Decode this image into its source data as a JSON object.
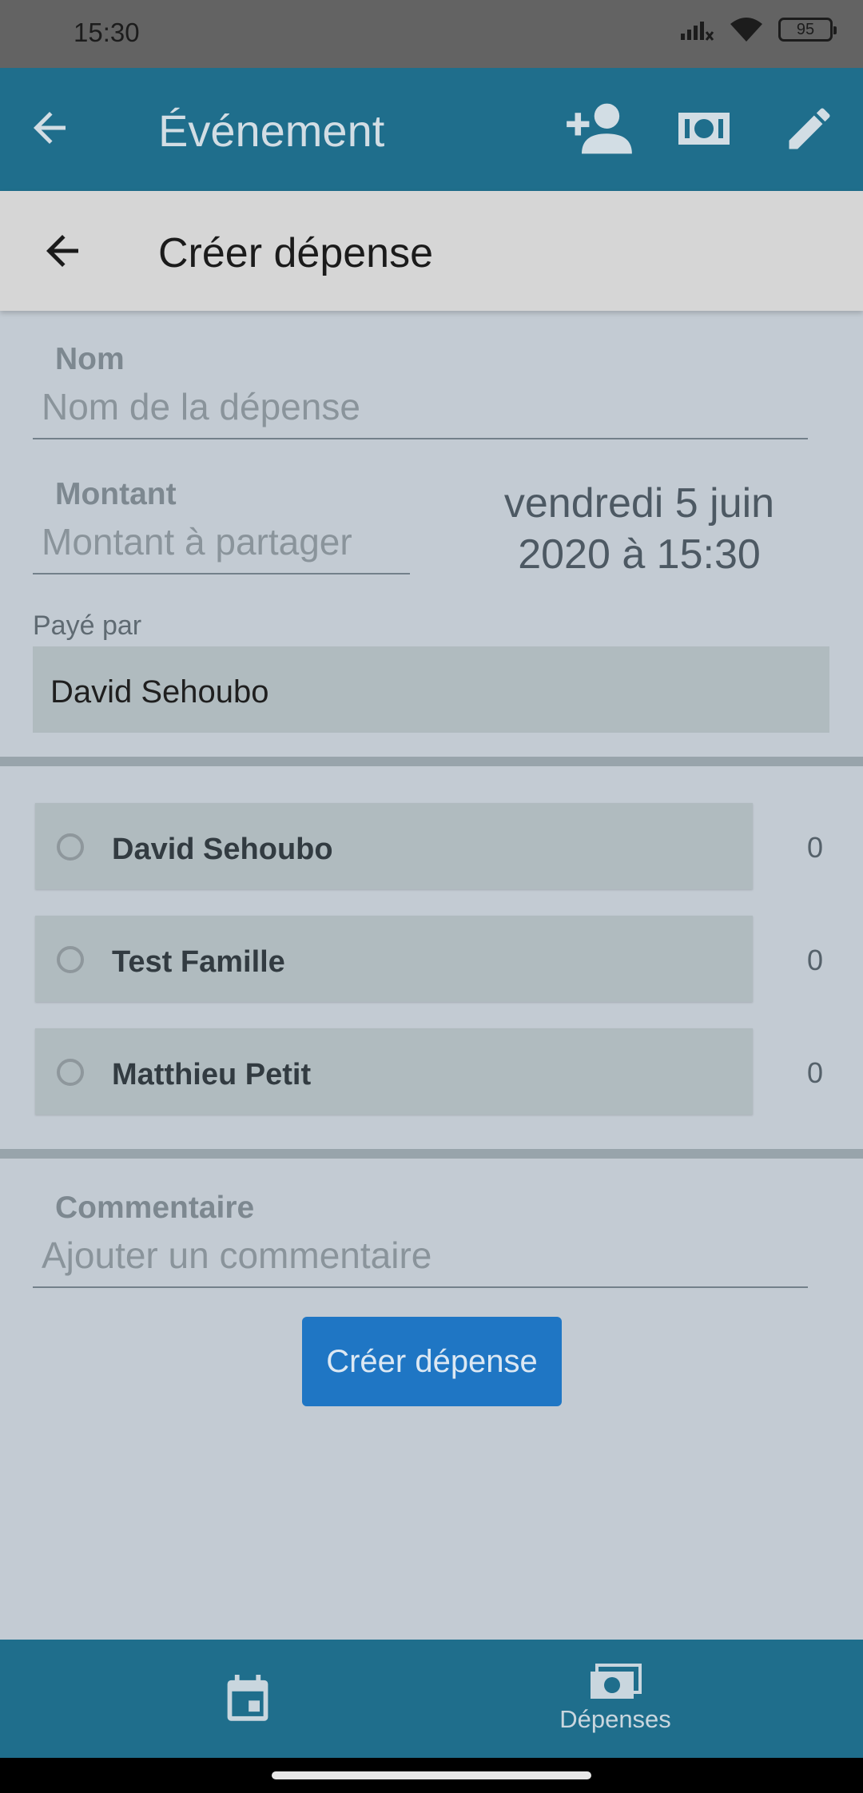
{
  "status_bar": {
    "time": "15:30",
    "battery": "95"
  },
  "app_bar": {
    "title": "Événement",
    "actions": [
      "add-person-icon",
      "money-icon",
      "edit-icon"
    ]
  },
  "sub_bar": {
    "title": "Créer dépense"
  },
  "form": {
    "name_label": "Nom",
    "name_placeholder": "Nom de la dépense",
    "amount_label": "Montant",
    "amount_placeholder": "Montant à partager",
    "date_line1": "vendredi 5 juin",
    "date_line2": "2020 à 15:30",
    "paid_by_label": "Payé par",
    "paid_by_value": "David Sehoubo",
    "comment_label": "Commentaire",
    "comment_placeholder": "Ajouter un commentaire",
    "submit_label": "Créer dépense"
  },
  "participants": [
    {
      "name": "David Sehoubo",
      "share": "0"
    },
    {
      "name": "Test Famille",
      "share": "0"
    },
    {
      "name": "Matthieu Petit",
      "share": "0"
    }
  ],
  "bottom_nav": {
    "items": [
      {
        "icon": "calendar-icon",
        "label": ""
      },
      {
        "icon": "money-icon",
        "label": "Dépenses"
      }
    ]
  },
  "colors": {
    "primary": "#1f6e8c",
    "button": "#1f76c4",
    "background": "#c3cbd3"
  }
}
